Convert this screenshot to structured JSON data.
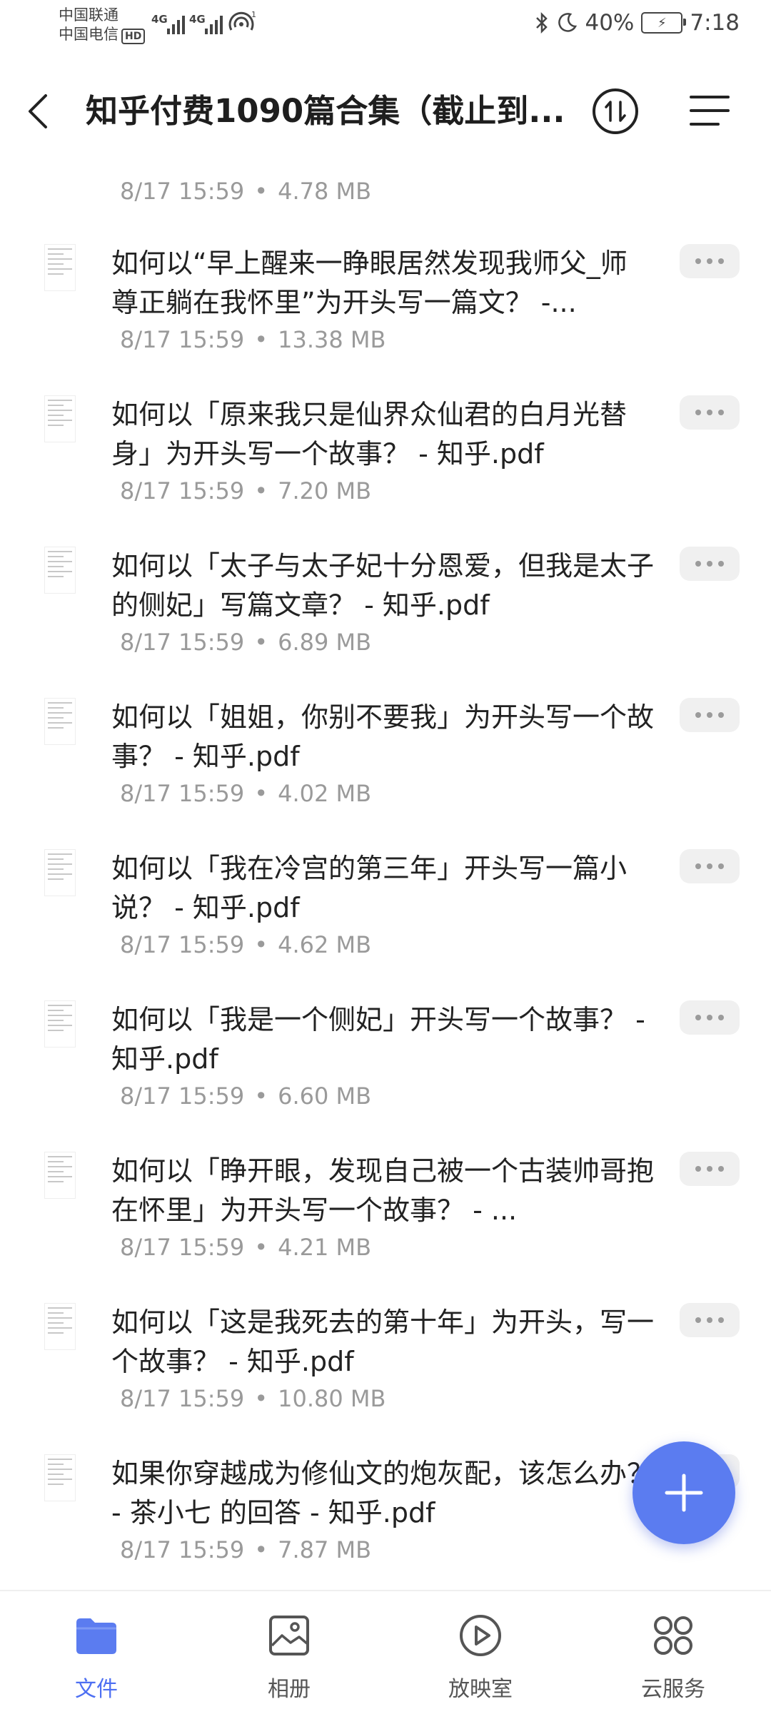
{
  "status": {
    "carrier1": "中国联通",
    "carrier2": "中国电信",
    "hd": "HD",
    "net1": "4G",
    "net2": "4G",
    "battery_pct": "40%",
    "time": "7:18"
  },
  "header": {
    "title": "知乎付费1090篇合集（截止到..."
  },
  "first_meta": {
    "date": "8/17 15:59",
    "size": "4.78 MB"
  },
  "files": [
    {
      "title": "如何以“早上醒来一睁眼居然发现我师父_师尊正躺在我怀里”为开头写一篇文？ -...",
      "date": "8/17 15:59",
      "size": "13.38 MB"
    },
    {
      "title": "如何以「原来我只是仙界众仙君的白月光替身」为开头写一个故事？ - 知乎.pdf",
      "date": "8/17 15:59",
      "size": "7.20 MB"
    },
    {
      "title": "如何以「太子与太子妃十分恩爱，但我是太子的侧妃」写篇文章？ - 知乎.pdf",
      "date": "8/17 15:59",
      "size": "6.89 MB"
    },
    {
      "title": "如何以「姐姐，你别不要我」为开头写一个故事？ - 知乎.pdf",
      "date": "8/17 15:59",
      "size": "4.02 MB"
    },
    {
      "title": "如何以「我在冷宫的第三年」开头写一篇小说？ - 知乎.pdf",
      "date": "8/17 15:59",
      "size": "4.62 MB"
    },
    {
      "title": "如何以「我是一个侧妃」开头写一个故事？ - 知乎.pdf",
      "date": "8/17 15:59",
      "size": "6.60 MB"
    },
    {
      "title": "如何以「睁开眼，发现自己被一个古装帅哥抱在怀里」为开头写一个故事？ - ...",
      "date": "8/17 15:59",
      "size": "4.21 MB"
    },
    {
      "title": "如何以「这是我死去的第十年」为开头，写一个故事？ - 知乎.pdf",
      "date": "8/17 15:59",
      "size": "10.80 MB"
    },
    {
      "title": "如果你穿越成为修仙文的炮灰配，该怎么办？ - 茶小七 的回答 - 知乎.pdf",
      "date": "8/17 15:59",
      "size": "7.87 MB"
    }
  ],
  "nav": {
    "files": "文件",
    "album": "相册",
    "theater": "放映室",
    "cloud": "云服务"
  },
  "colors": {
    "accent": "#5b7cf0",
    "active_label": "#4d6ff2",
    "meta_text": "#9a9a9a"
  }
}
